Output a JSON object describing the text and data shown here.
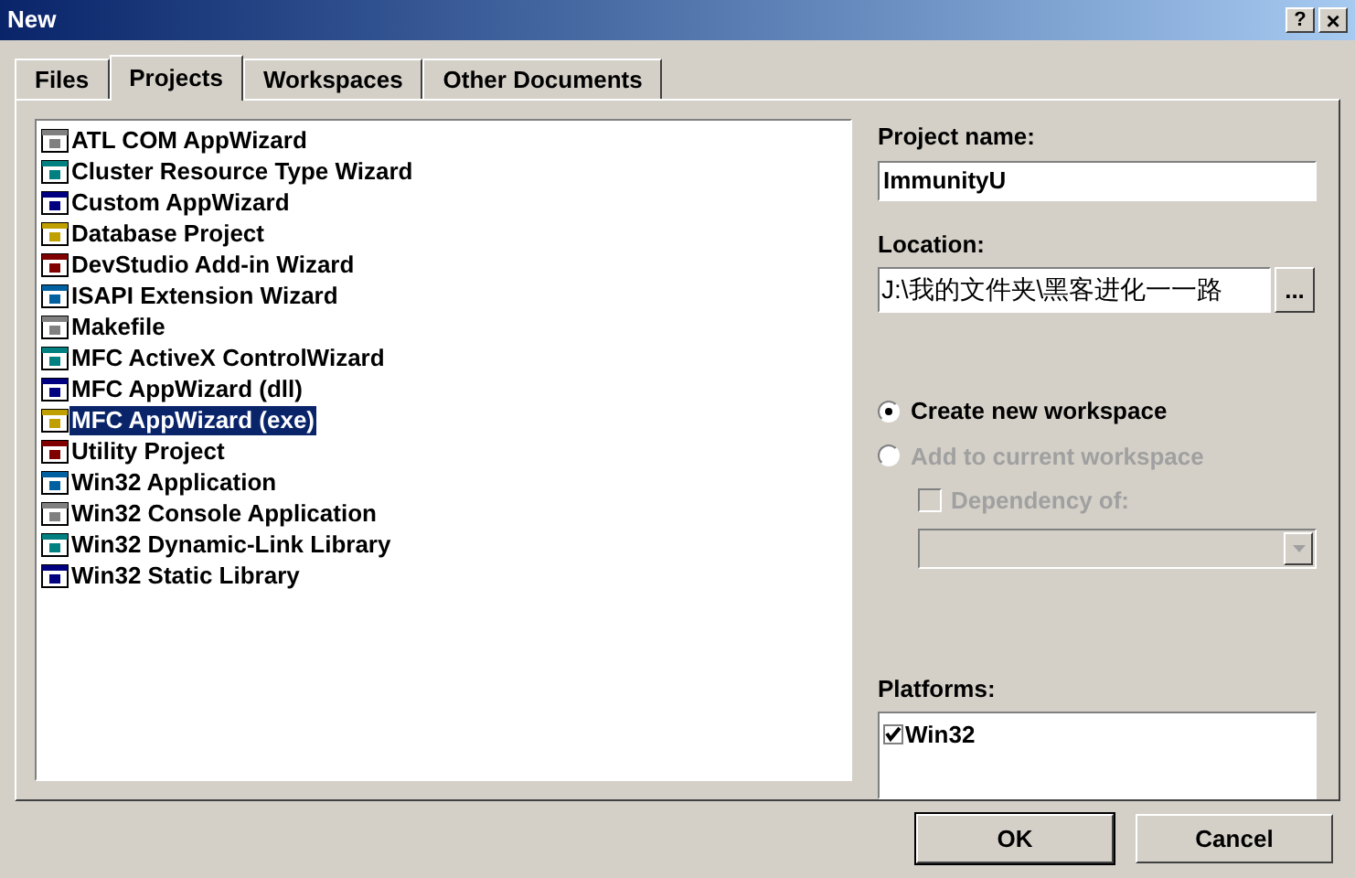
{
  "window": {
    "title": "New",
    "help": "?",
    "close": "×"
  },
  "tabs": [
    {
      "label": "Files",
      "selected": false
    },
    {
      "label": "Projects",
      "selected": true
    },
    {
      "label": "Workspaces",
      "selected": false
    },
    {
      "label": "Other Documents",
      "selected": false
    }
  ],
  "projects": [
    {
      "label": "ATL COM AppWizard",
      "selected": false
    },
    {
      "label": "Cluster Resource Type Wizard",
      "selected": false
    },
    {
      "label": "Custom AppWizard",
      "selected": false
    },
    {
      "label": "Database Project",
      "selected": false
    },
    {
      "label": "DevStudio Add-in Wizard",
      "selected": false
    },
    {
      "label": "ISAPI Extension Wizard",
      "selected": false
    },
    {
      "label": "Makefile",
      "selected": false
    },
    {
      "label": "MFC ActiveX ControlWizard",
      "selected": false
    },
    {
      "label": "MFC AppWizard (dll)",
      "selected": false
    },
    {
      "label": "MFC AppWizard (exe)",
      "selected": true
    },
    {
      "label": "Utility Project",
      "selected": false
    },
    {
      "label": "Win32 Application",
      "selected": false
    },
    {
      "label": "Win32 Console Application",
      "selected": false
    },
    {
      "label": "Win32 Dynamic-Link Library",
      "selected": false
    },
    {
      "label": "Win32 Static Library",
      "selected": false
    }
  ],
  "project_name": {
    "label": "Project name:",
    "value": "ImmunityU"
  },
  "location": {
    "label": "Location:",
    "value": "J:\\我的文件夹\\黑客进化一一路",
    "browse": "..."
  },
  "workspace_options": [
    {
      "label": "Create new workspace",
      "selected": true,
      "disabled": false
    },
    {
      "label": "Add to current workspace",
      "selected": false,
      "disabled": true
    }
  ],
  "dependency": {
    "label": "Dependency of:",
    "checked": false,
    "disabled": true
  },
  "platforms": {
    "label": "Platforms:",
    "items": [
      {
        "label": "Win32",
        "checked": true
      }
    ]
  },
  "buttons": [
    "OK",
    "Cancel"
  ]
}
